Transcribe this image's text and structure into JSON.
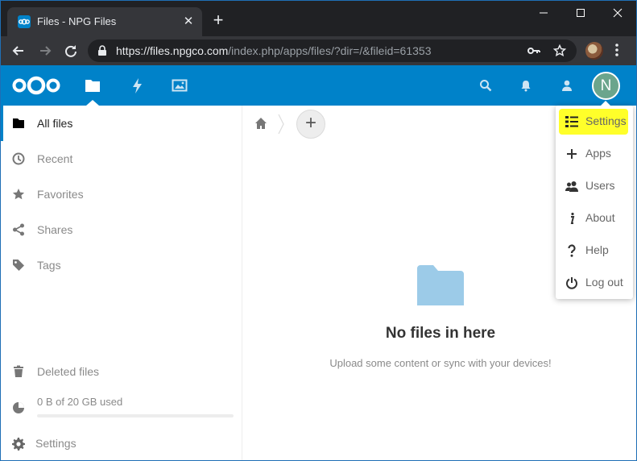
{
  "browser": {
    "tab_title": "Files - NPG Files",
    "url_host": "https://files.npgco.com",
    "url_path": "/index.php/apps/files/?dir=/&fileid=61353",
    "tab_close_glyph": "✕",
    "new_tab_glyph": "+"
  },
  "header": {
    "avatar_initial": "N",
    "brand_color": "#0082c9",
    "apps": [
      "folder-icon",
      "lightning-icon",
      "image-icon"
    ]
  },
  "sidebar": {
    "items": [
      {
        "label": "All files",
        "icon": "folder-icon",
        "active": true
      },
      {
        "label": "Recent",
        "icon": "clock-icon"
      },
      {
        "label": "Favorites",
        "icon": "star-icon"
      },
      {
        "label": "Shares",
        "icon": "share-icon"
      },
      {
        "label": "Tags",
        "icon": "tag-icon"
      }
    ],
    "deleted_label": "Deleted files",
    "quota_text": "0 B of 20 GB used",
    "quota_fraction": 0,
    "settings_label": "Settings"
  },
  "content": {
    "add_glyph": "+",
    "empty_title": "No files in here",
    "empty_hint": "Upload some content or sync with your devices!"
  },
  "user_menu": {
    "items": [
      {
        "label": "Settings",
        "icon": "list-icon",
        "highlighted": true
      },
      {
        "label": "Apps",
        "icon": "plus-icon"
      },
      {
        "label": "Users",
        "icon": "users-icon"
      },
      {
        "label": "About",
        "icon": "info-icon"
      },
      {
        "label": "Help",
        "icon": "question-icon"
      },
      {
        "label": "Log out",
        "icon": "power-icon"
      }
    ],
    "highlight_color": "#ffff2a"
  }
}
